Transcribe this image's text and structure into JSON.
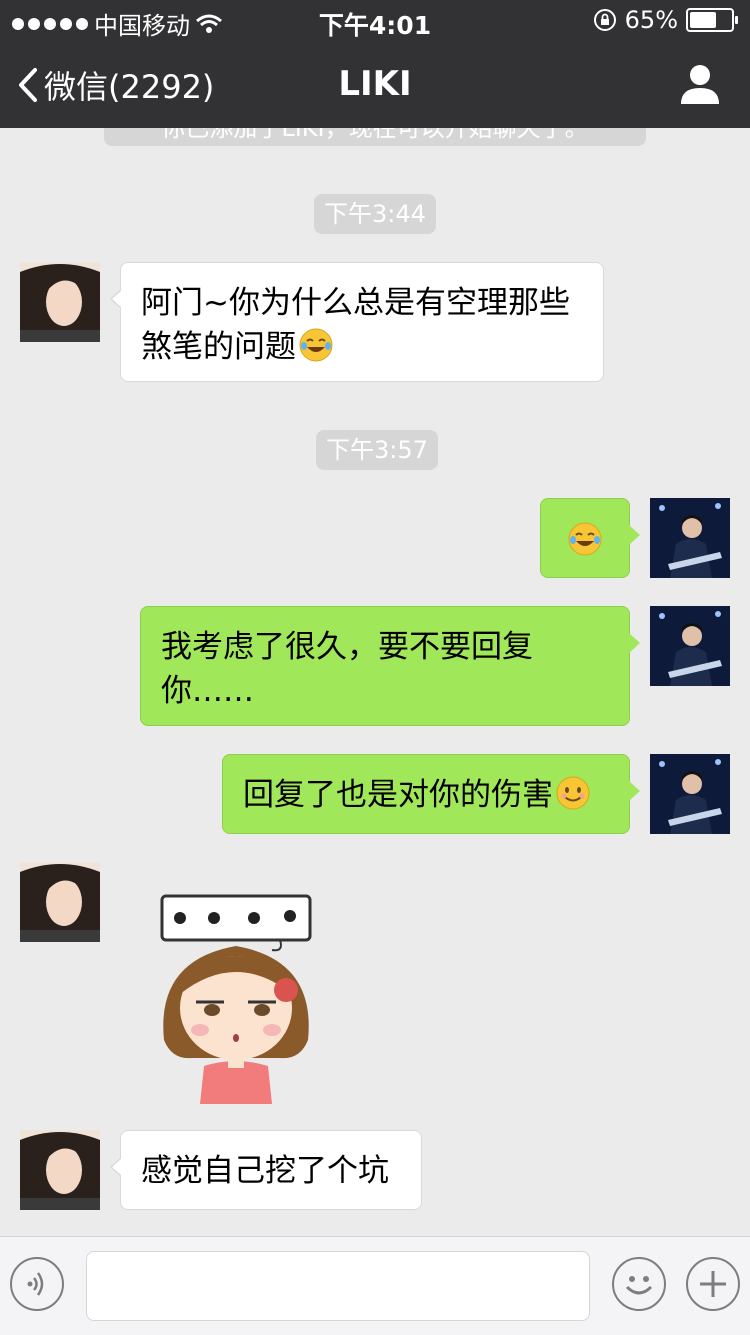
{
  "status_bar": {
    "carrier": "中国移动",
    "time": "下午4:01",
    "battery_percent": "65%",
    "battery_level": 0.65
  },
  "nav": {
    "back_label": "微信(2292)",
    "title": "LIKI"
  },
  "system_note": "你已添加了LIKI，现在可以开始聊天了。",
  "timestamps": [
    "下午3:44",
    "下午3:57"
  ],
  "messages": [
    {
      "from": "contact",
      "text": "阿门~你为什么总是有空理那些煞笔的问题",
      "emoji": "tears-of-joy"
    },
    {
      "from": "me",
      "text": "",
      "emoji": "tears-of-joy"
    },
    {
      "from": "me",
      "text": "我考虑了很久，要不要回复你……"
    },
    {
      "from": "me",
      "text": "回复了也是对你的伤害",
      "emoji": "smile"
    },
    {
      "from": "contact",
      "type": "sticker",
      "sticker": "girl-sticker-speechless"
    },
    {
      "from": "contact",
      "text": "感觉自己挖了个坑"
    }
  ],
  "icons": {
    "voice": "voice-icon",
    "emoji": "emoji-icon",
    "more": "plus-icon",
    "profile": "person-icon"
  },
  "colors": {
    "nav_bg": "#323234",
    "chat_bg": "#ebebeb",
    "outgoing_bubble": "#a0e75a",
    "incoming_bubble": "#ffffff"
  }
}
